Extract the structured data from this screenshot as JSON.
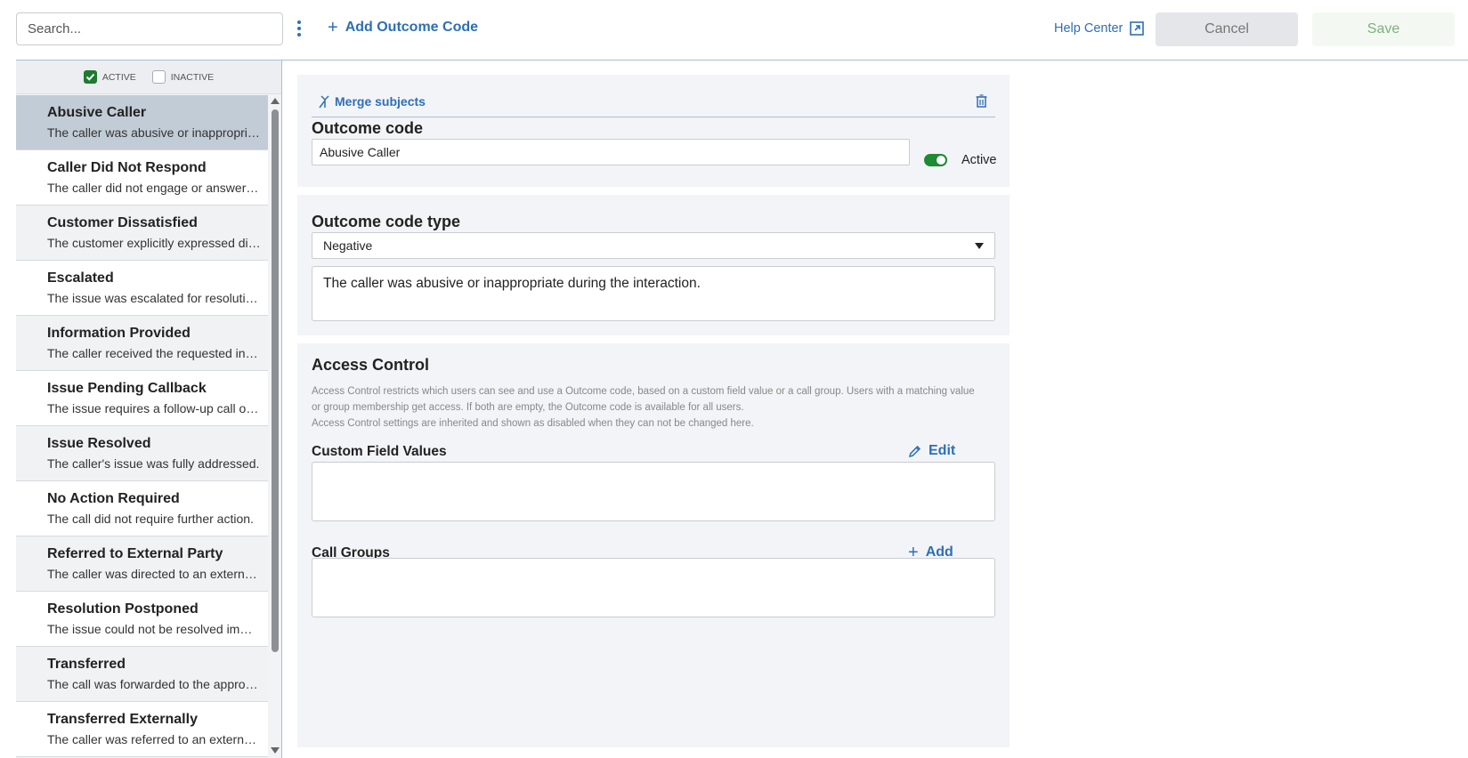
{
  "toolbar": {
    "search_placeholder": "Search...",
    "more_icon": "kebab-vertical-icon",
    "add_label": "Add Outcome Code",
    "help_label": "Help Center",
    "cancel_label": "Cancel",
    "save_label": "Save"
  },
  "filters": {
    "active_label": "ACTIVE",
    "active_checked": true,
    "inactive_label": "INACTIVE",
    "inactive_checked": false
  },
  "sidebar": {
    "items": [
      {
        "title": "Abusive Caller",
        "desc": "The caller was abusive or inappropriate during the interaction."
      },
      {
        "title": "Caller Did Not Respond",
        "desc": "The caller did not engage or answer the call."
      },
      {
        "title": "Customer Dissatisfied",
        "desc": "The customer explicitly expressed dissatisfaction."
      },
      {
        "title": "Escalated",
        "desc": "The issue was escalated for resolution."
      },
      {
        "title": "Information Provided",
        "desc": "The caller received the requested information."
      },
      {
        "title": "Issue Pending Callback",
        "desc": "The issue requires a follow-up call or action."
      },
      {
        "title": "Issue Resolved",
        "desc": "The caller's issue was fully addressed."
      },
      {
        "title": "No Action Required",
        "desc": "The call did not require further action."
      },
      {
        "title": "Referred to External Party",
        "desc": "The caller was directed to an external party."
      },
      {
        "title": "Resolution Postponed",
        "desc": "The issue could not be resolved immediately."
      },
      {
        "title": "Transferred",
        "desc": "The call was forwarded to the appropriate department."
      },
      {
        "title": "Transferred Externally",
        "desc": "The caller was referred to an external contact."
      }
    ],
    "selected_index": 0
  },
  "detail": {
    "merge_label": "Merge subjects",
    "outcome_code_label": "Outcome code",
    "outcome_code_value": "Abusive Caller",
    "active_label": "Active",
    "active": true,
    "type_label": "Outcome code type",
    "type_value": "Negative",
    "description": "The caller was abusive or inappropriate during the interaction."
  },
  "access": {
    "title": "Access Control",
    "desc_line1": "Access Control restricts which users can see and use a Outcome code, based on a custom field value or a call group. Users with a matching value",
    "desc_line2": "or group membership get access. If both are empty, the Outcome code is available for all users.",
    "desc_line3": "Access Control settings are inherited and shown as disabled when they can not be changed here.",
    "custom_fields_label": "Custom Field Values",
    "edit_label": "Edit",
    "call_groups_label": "Call Groups",
    "add_label": "Add"
  },
  "colors": {
    "accent": "#2e6fb5",
    "active_green": "#1e8a33",
    "selected_row": "#c2ccd6"
  }
}
